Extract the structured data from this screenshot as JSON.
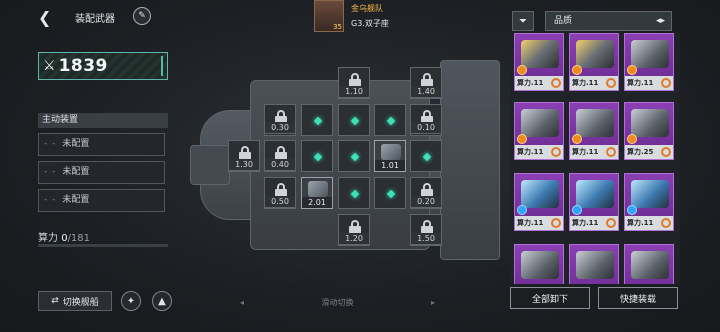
{
  "header": {
    "back_icon": "chevron-left-icon",
    "title": "装配武器",
    "edit_icon": "pencil-icon"
  },
  "power": {
    "icon": "crossed-swords-icon",
    "value": "1839"
  },
  "fleet": {
    "name": "金乌舰队",
    "level": "35",
    "formation": "G3.双子座"
  },
  "active_gear": {
    "header": "主动装置",
    "slots": [
      {
        "dash": "- -",
        "label": "未配置"
      },
      {
        "dash": "- -",
        "label": "未配置"
      },
      {
        "dash": "- -",
        "label": "未配置"
      }
    ]
  },
  "compute": {
    "label": "算力",
    "current": "0",
    "total": "/181"
  },
  "bottom_left": {
    "switch_ship": "切换舰船",
    "switch_icon": "swap-arrows-icon",
    "btn1_icon": "wing-emblem-icon",
    "btn2_icon": "triangle-emblem-icon"
  },
  "swipe_hint": {
    "left": "◂",
    "text": "滑动切换",
    "right": "▸"
  },
  "grid_labels": {
    "top_a": "1.10",
    "top_b": "1.40",
    "r1_a": "0.30",
    "r1_b": "0.10",
    "r2_a": "1.30",
    "r2_b": "0.40",
    "r2_eq": "1.01",
    "r3_a": "0.50",
    "r3_eq": "2.01",
    "r3_b": "0.20",
    "bot_a": "1.20",
    "bot_b": "1.50"
  },
  "right_panel": {
    "filter_icon": "funnel-icon",
    "sort_label": "品质",
    "sort_arrows": "◂▸",
    "cards": [
      {
        "text": "算力.11"
      },
      {
        "text": "算力.11"
      },
      {
        "text": "算力.11"
      },
      {
        "text": "算力.11"
      },
      {
        "text": "算力.11"
      },
      {
        "text": "算力.25"
      },
      {
        "text": "算力.11"
      },
      {
        "text": "算力.11"
      },
      {
        "text": "算力.11"
      }
    ],
    "unequip_all": "全部卸下",
    "quick_equip": "快捷装载"
  },
  "colors": {
    "accent_teal": "#3de0b8",
    "card_purple": "#8b3fb4",
    "fleet_orange": "#ffb84a"
  }
}
